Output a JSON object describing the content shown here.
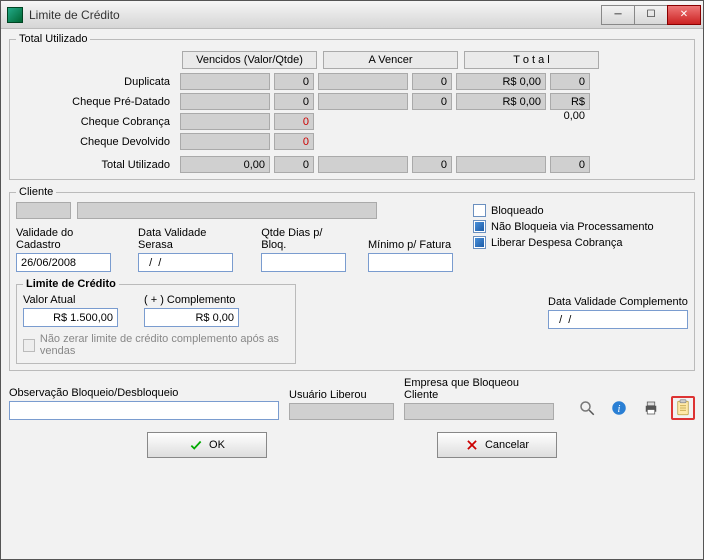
{
  "window": {
    "title": "Limite de Crédito",
    "minimize_glyph": "─",
    "maximize_glyph": "☐",
    "close_glyph": "✕"
  },
  "total_utilizado": {
    "legend": "Total Utilizado",
    "headers": {
      "vencidos": "Vencidos (Valor/Qtde)",
      "avencer": "A Vencer",
      "total": "T o t a l"
    },
    "rows": [
      {
        "label": "Duplicata",
        "venc_val": "",
        "venc_qtd": "0",
        "av_val": "",
        "av_qtd": "0",
        "tot_val": "R$ 0,00",
        "tot_qtd": "0",
        "red": false
      },
      {
        "label": "Cheque Pré-Datado",
        "venc_val": "",
        "venc_qtd": "0",
        "av_val": "",
        "av_qtd": "0",
        "tot_val": "R$ 0,00",
        "tot_qtd": "R$ 0,00",
        "red": false
      },
      {
        "label": "Cheque Cobrança",
        "venc_val": "",
        "venc_qtd": "0",
        "av_val": "",
        "av_qtd": "",
        "tot_val": "",
        "tot_qtd": "",
        "red": true
      },
      {
        "label": "Cheque Devolvido",
        "venc_val": "",
        "venc_qtd": "0",
        "av_val": "",
        "av_qtd": "",
        "tot_val": "",
        "tot_qtd": "",
        "red": true
      }
    ],
    "total_row": {
      "label": "Total Utilizado",
      "c1": "0,00",
      "c2": "0",
      "c3": "",
      "c4": "0",
      "c5": "",
      "c6": "0"
    }
  },
  "cliente": {
    "legend": "Cliente",
    "checkboxes": {
      "bloqueado": {
        "label": "Bloqueado",
        "checked": false
      },
      "nao_bloqueia": {
        "label": "Não Bloqueia via Processamento",
        "checked": true
      },
      "liberar_despesa": {
        "label": "Liberar Despesa Cobrança",
        "checked": true
      }
    },
    "fields": {
      "validade_cadastro": {
        "label": "Validade do Cadastro",
        "value": "26/06/2008"
      },
      "validade_serasa": {
        "label": "Data Validade Serasa",
        "value": "  /  /"
      },
      "qtde_dias_bloq": {
        "label": "Qtde Dias p/ Bloq.",
        "value": ""
      },
      "minimo_fatura": {
        "label": "Mínimo p/ Fatura",
        "value": ""
      }
    },
    "limite": {
      "legend": "Limite de Crédito",
      "valor_atual": {
        "label": "Valor Atual",
        "value": "R$ 1.500,00"
      },
      "complemento": {
        "label": "( + ) Complemento",
        "value": "R$ 0,00"
      },
      "nao_zerar": {
        "label": "Não zerar limite de crédito complemento após  as vendas",
        "checked": false
      }
    },
    "validade_complemento": {
      "label": "Data Validade Complemento",
      "value": "  /  /"
    }
  },
  "bottom": {
    "obs": {
      "label": "Observação Bloqueio/Desbloqueio",
      "value": ""
    },
    "usuario_liberou": {
      "label": "Usuário Liberou"
    },
    "empresa_bloqueou": {
      "label": "Empresa que Bloqueou Cliente"
    }
  },
  "buttons": {
    "ok": "OK",
    "cancel": "Cancelar"
  },
  "icons": {
    "search": "search-icon",
    "info": "info-icon",
    "print": "print-icon",
    "clipboard": "clipboard-icon"
  }
}
